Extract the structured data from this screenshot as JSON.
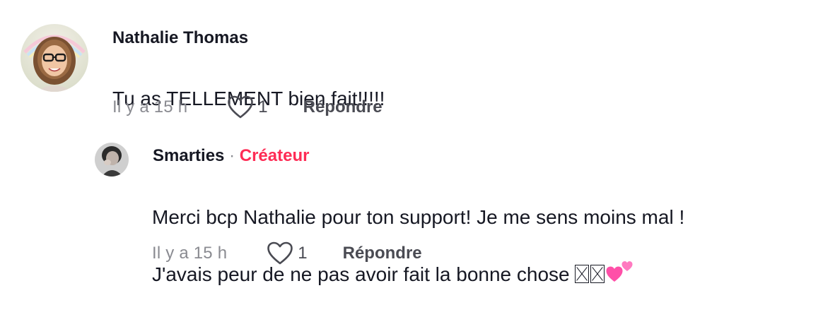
{
  "comment": {
    "author": "Nathalie Thomas",
    "text": "Tu as TELLEMENT bien fait!!!!!",
    "timestamp": "Il y a 15 h",
    "likes": "1",
    "reply_label": "Répondre"
  },
  "reply": {
    "author": "Smarties",
    "separator": "·",
    "badge": "Créateur",
    "text_line1": "Merci bcp Nathalie pour ton support! Je me sens moins mal !",
    "text_line2": "J'avais peur de ne pas avoir fait la bonne chose",
    "timestamp": "Il y a 15 h",
    "likes": "1",
    "reply_label": "Répondre"
  },
  "colors": {
    "creator_badge": "#fe2c55",
    "muted_text": "#8a8b91",
    "emoji_heart": "#ff4fa8"
  },
  "icons": {
    "like": "heart-outline-icon",
    "emoji": "two-hearts-icon"
  }
}
